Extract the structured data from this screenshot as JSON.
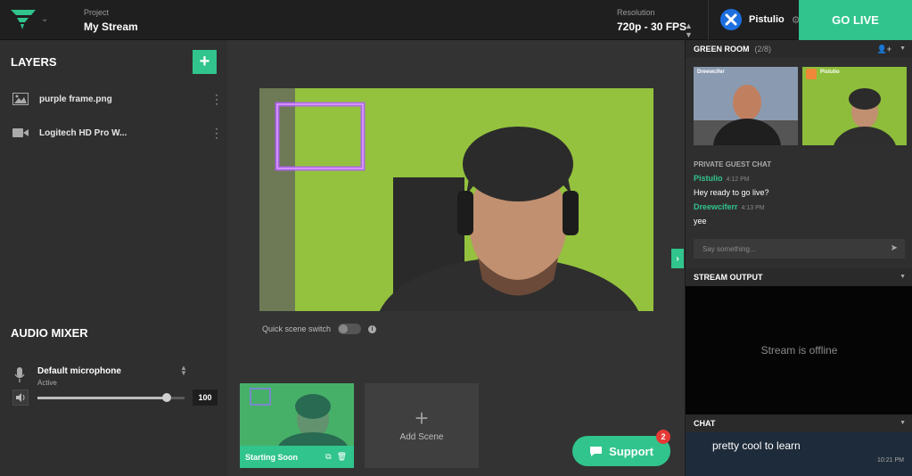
{
  "header": {
    "project_label": "Project",
    "project_name": "My Stream",
    "resolution_label": "Resolution",
    "resolution_value": "720p - 30 FPS",
    "user_name": "Pistulio",
    "go_live": "GO LIVE"
  },
  "layers": {
    "title": "LAYERS",
    "items": [
      {
        "label": "purple frame.png",
        "icon": "image-icon"
      },
      {
        "label": "Logitech HD Pro W...",
        "icon": "camera-icon"
      }
    ]
  },
  "audio": {
    "title": "AUDIO MIXER",
    "device": "Default microphone",
    "status": "Active",
    "volume": "100",
    "volume_fraction": 0.88
  },
  "center": {
    "quick_switch": "Quick scene switch",
    "scene_name": "Starting Soon",
    "add_scene": "Add Scene",
    "support": "Support",
    "support_badge": "2"
  },
  "green_room": {
    "title": "GREEN ROOM",
    "count": "(2/8)",
    "guests": [
      {
        "name": "Dreewcifer"
      },
      {
        "name": "Pistulio"
      }
    ],
    "private_chat_title": "PRIVATE GUEST CHAT",
    "messages": [
      {
        "user": "Pistulio",
        "time": "4:12 PM",
        "text": "Hey ready to go live?"
      },
      {
        "user": "Dreewciferr",
        "time": "4:13 PM",
        "text": "yee"
      }
    ],
    "input_placeholder": "Say something..."
  },
  "stream_output": {
    "title": "STREAM OUTPUT",
    "status": "Stream is offline"
  },
  "chat": {
    "title": "CHAT",
    "last_message": "pretty cool to learn",
    "last_time": "10:21 PM"
  },
  "colors": {
    "accent": "#31c48d",
    "topbar": "#1f1f1f",
    "panel": "#2f2f2f",
    "badge": "#e53935"
  }
}
